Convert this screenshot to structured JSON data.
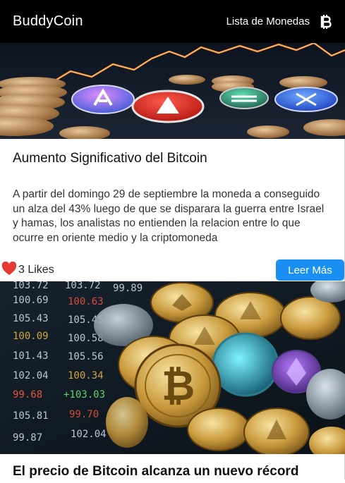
{
  "header": {
    "brand": "BuddyCoin",
    "nav_link": "Lista de Monedas",
    "nav_icon": "bitcoin-icon"
  },
  "colors": {
    "header_bg": "#000000",
    "button_bg": "#1a90f5",
    "heart": "#e53935"
  },
  "posts": [
    {
      "title": "Aumento Significativo del Bitcoin",
      "text": "A partir del domingo 29 de septiembre la moneda a conseguido un alza del 43% luego de que se disparara la guerra entre Israel y hamas, los analistas no entienden la relacion entre lo que ocurre en oriente medio y la criptomoneda",
      "likes": "3 Likes",
      "button": "Leer Más"
    },
    {
      "title": "El precio de Bitcoin alcanza un nuevo récord",
      "ticker_left": [
        "103.72",
        "100.69",
        "105.43",
        "100.09",
        "101.43",
        "102.04",
        "99.68",
        "105.81",
        "99.87"
      ],
      "ticker_right": [
        "99.89",
        "100.63",
        "105.45",
        "100.58",
        "105.56",
        "100.34",
        "+103.03",
        "99.70",
        "102.04"
      ]
    }
  ]
}
